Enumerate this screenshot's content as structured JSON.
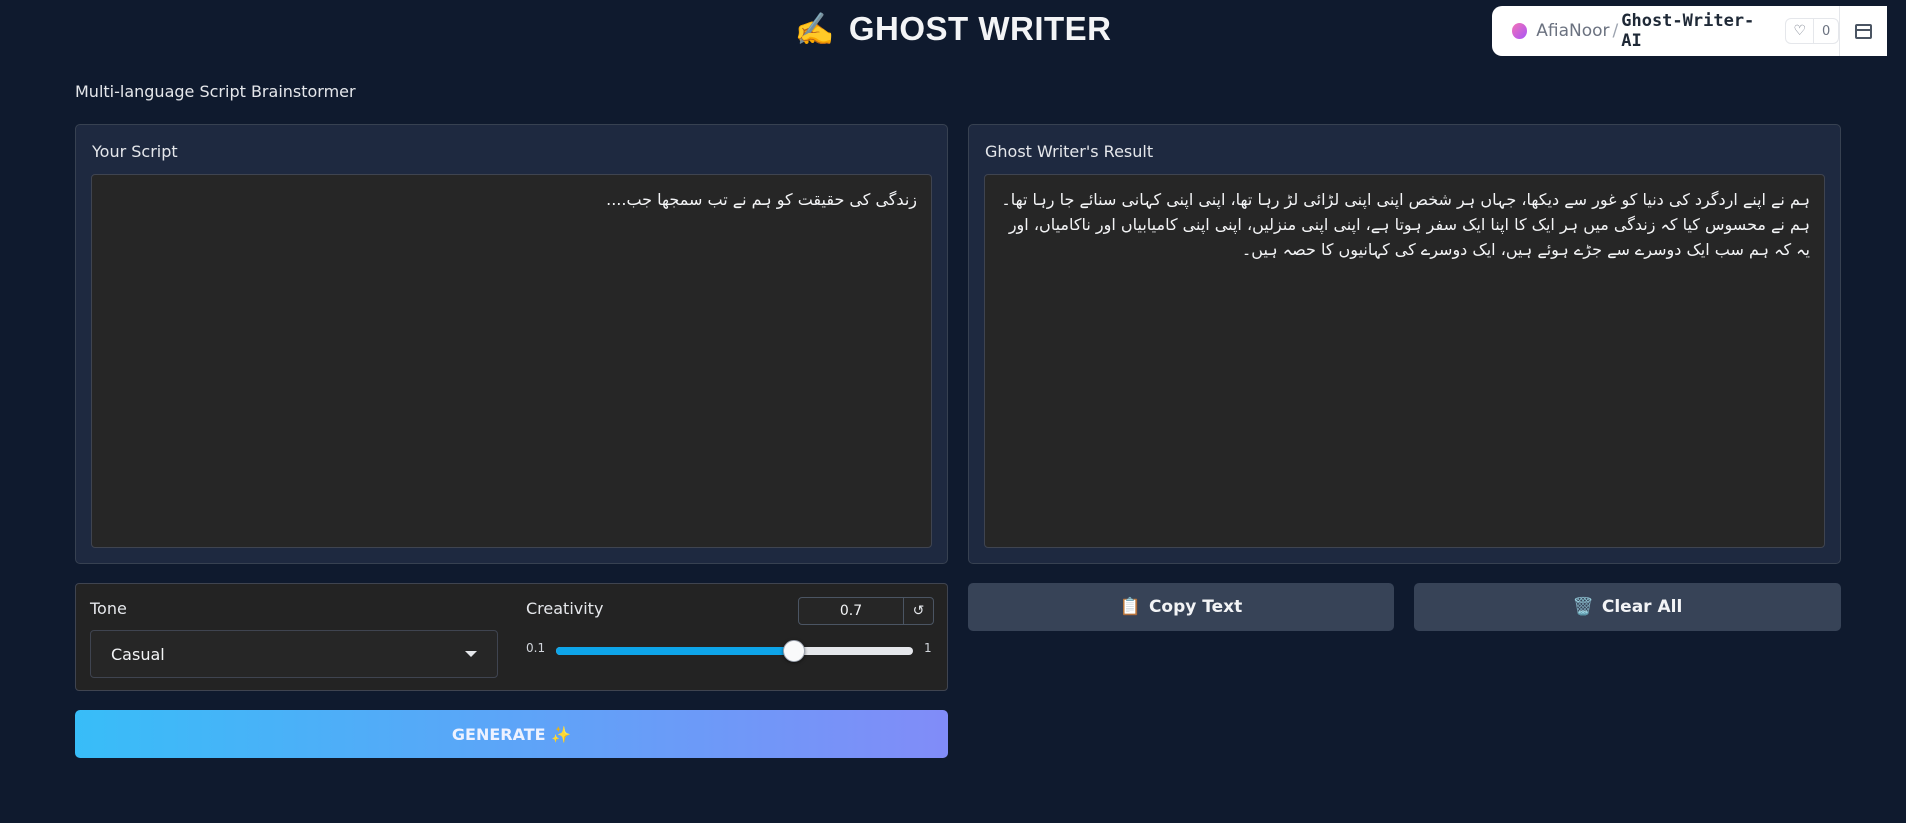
{
  "header": {
    "icon": "writing-hand-emoji",
    "emoji": "✍️",
    "title": "GHOST WRITER",
    "subtitle": "Multi-language Script Brainstormer"
  },
  "space_badge": {
    "owner": "AfiaNoor",
    "separator": "/",
    "repo": "Ghost-Writer-AI",
    "like_icon": "♡",
    "likes": "0"
  },
  "script_panel": {
    "label": "Your Script",
    "value": "زندگی کی حقیقت کو ہم نے تب سمجھا جب...."
  },
  "result_panel": {
    "label": "Ghost Writer's Result",
    "value": "ہم نے اپنے اردگرد کی دنیا کو غور سے دیکھا، جہاں ہر شخص اپنی اپنی لڑائی لڑ رہا تھا، اپنی اپنی کہانی سنائے جا رہا تھا۔ ہم نے محسوس کیا کہ زندگی میں ہر ایک کا اپنا ایک سفر ہوتا ہے، اپنی اپنی منزلیں، اپنی اپنی کامیابیاں اور ناکامیاں، اور یہ کہ ہم سب ایک دوسرے سے جڑے ہوئے ہیں، ایک دوسرے کی کہانیوں کا حصہ ہیں۔"
  },
  "controls": {
    "tone_label": "Tone",
    "tone_value": "Casual",
    "creativity_label": "Creativity",
    "creativity_value": "0.7",
    "creativity_min": "0.1",
    "creativity_max": "1",
    "creativity_fraction": 0.667,
    "reset_icon": "↺"
  },
  "buttons": {
    "copy_icon": "📋",
    "copy_label": "Copy Text",
    "clear_icon": "🗑️",
    "clear_label": "Clear All",
    "generate_label": "GENERATE ✨"
  },
  "colors": {
    "background": "#0f1a2e",
    "panel": "#1e2940",
    "accent": "#0ea5e9",
    "gradient_start": "#38bdf8",
    "gradient_end": "#818cf8"
  }
}
